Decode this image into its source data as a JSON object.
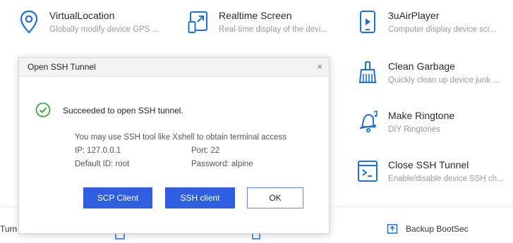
{
  "tools": [
    {
      "title": "VirtualLocation",
      "desc": "Globally modify device GPS ...",
      "icon": "location-pin-icon"
    },
    {
      "title": "Realtime Screen",
      "desc": "Real-time display of the devi...",
      "icon": "screen-cast-icon"
    },
    {
      "title": "3uAirPlayer",
      "desc": "Computer display device scr...",
      "icon": "airplayer-icon"
    },
    {
      "title": "Clean Garbage",
      "desc": "Quickly clean up device junk ...",
      "icon": "broom-icon"
    },
    {
      "title": "Make Ringtone",
      "desc": "DIY Ringtones",
      "icon": "bell-music-icon"
    },
    {
      "title": "Close SSH Tunnel",
      "desc": "Enable/disable device SSH ch...",
      "icon": "terminal-icon"
    }
  ],
  "bottom": {
    "left_label": "Turn",
    "right_label": "Backup BootSec"
  },
  "dialog": {
    "title": "Open SSH Tunnel",
    "close_symbol": "×",
    "message": "Succeeded to open SSH tunnel.",
    "hint": "You may use SSH tool like Xshell to obtain terminal access",
    "ip": "IP: 127.0.0.1",
    "port": "Port: 22",
    "default_id": "Default ID: root",
    "password": "Password: alpine",
    "buttons": {
      "scp": "SCP Client",
      "ssh": "SSH client",
      "ok": "OK"
    }
  },
  "colors": {
    "accent": "#2f5fe0",
    "icon_blue": "#1f6fd6",
    "success_green": "#3aa63a"
  }
}
